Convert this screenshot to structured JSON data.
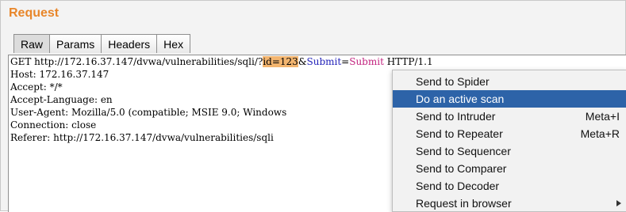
{
  "panel": {
    "title": "Request"
  },
  "tabs": [
    {
      "label": "Raw"
    },
    {
      "label": "Params"
    },
    {
      "label": "Headers"
    },
    {
      "label": "Hex"
    }
  ],
  "request": {
    "line1": {
      "prefix": "GET http://172.16.37.147/dvwa/vulnerabilities/sqli/?",
      "highlight": "id=123",
      "amp": "&",
      "param_name": "Submit",
      "eq": "=",
      "param_value": "Submit",
      "suffix": " HTTP/1.1"
    },
    "line2": "Host: 172.16.37.147",
    "line3": "Accept: */*",
    "line4": "Accept-Language: en",
    "line5": "User-Agent: Mozilla/5.0 (compatible; MSIE 9.0; Windows",
    "line6": "Connection: close",
    "line7": "Referer: http://172.16.37.147/dvwa/vulnerabilities/sqli"
  },
  "context_menu": {
    "items": [
      {
        "label": "Send to Spider",
        "shortcut": ""
      },
      {
        "label": "Do an active scan",
        "shortcut": "",
        "selected": true
      },
      {
        "label": "Send to Intruder",
        "shortcut": "Meta+I"
      },
      {
        "label": "Send to Repeater",
        "shortcut": "Meta+R"
      },
      {
        "label": "Send to Sequencer",
        "shortcut": ""
      },
      {
        "label": "Send to Comparer",
        "shortcut": ""
      },
      {
        "label": "Send to Decoder",
        "shortcut": ""
      },
      {
        "label": "Request in browser",
        "shortcut": "",
        "submenu": true
      }
    ]
  },
  "colors": {
    "title": "#e8862a",
    "param_name": "#1f1fb8",
    "param_value": "#c2227e",
    "highlight": "#f3b56f",
    "menu_selected": "#2d63a8"
  }
}
